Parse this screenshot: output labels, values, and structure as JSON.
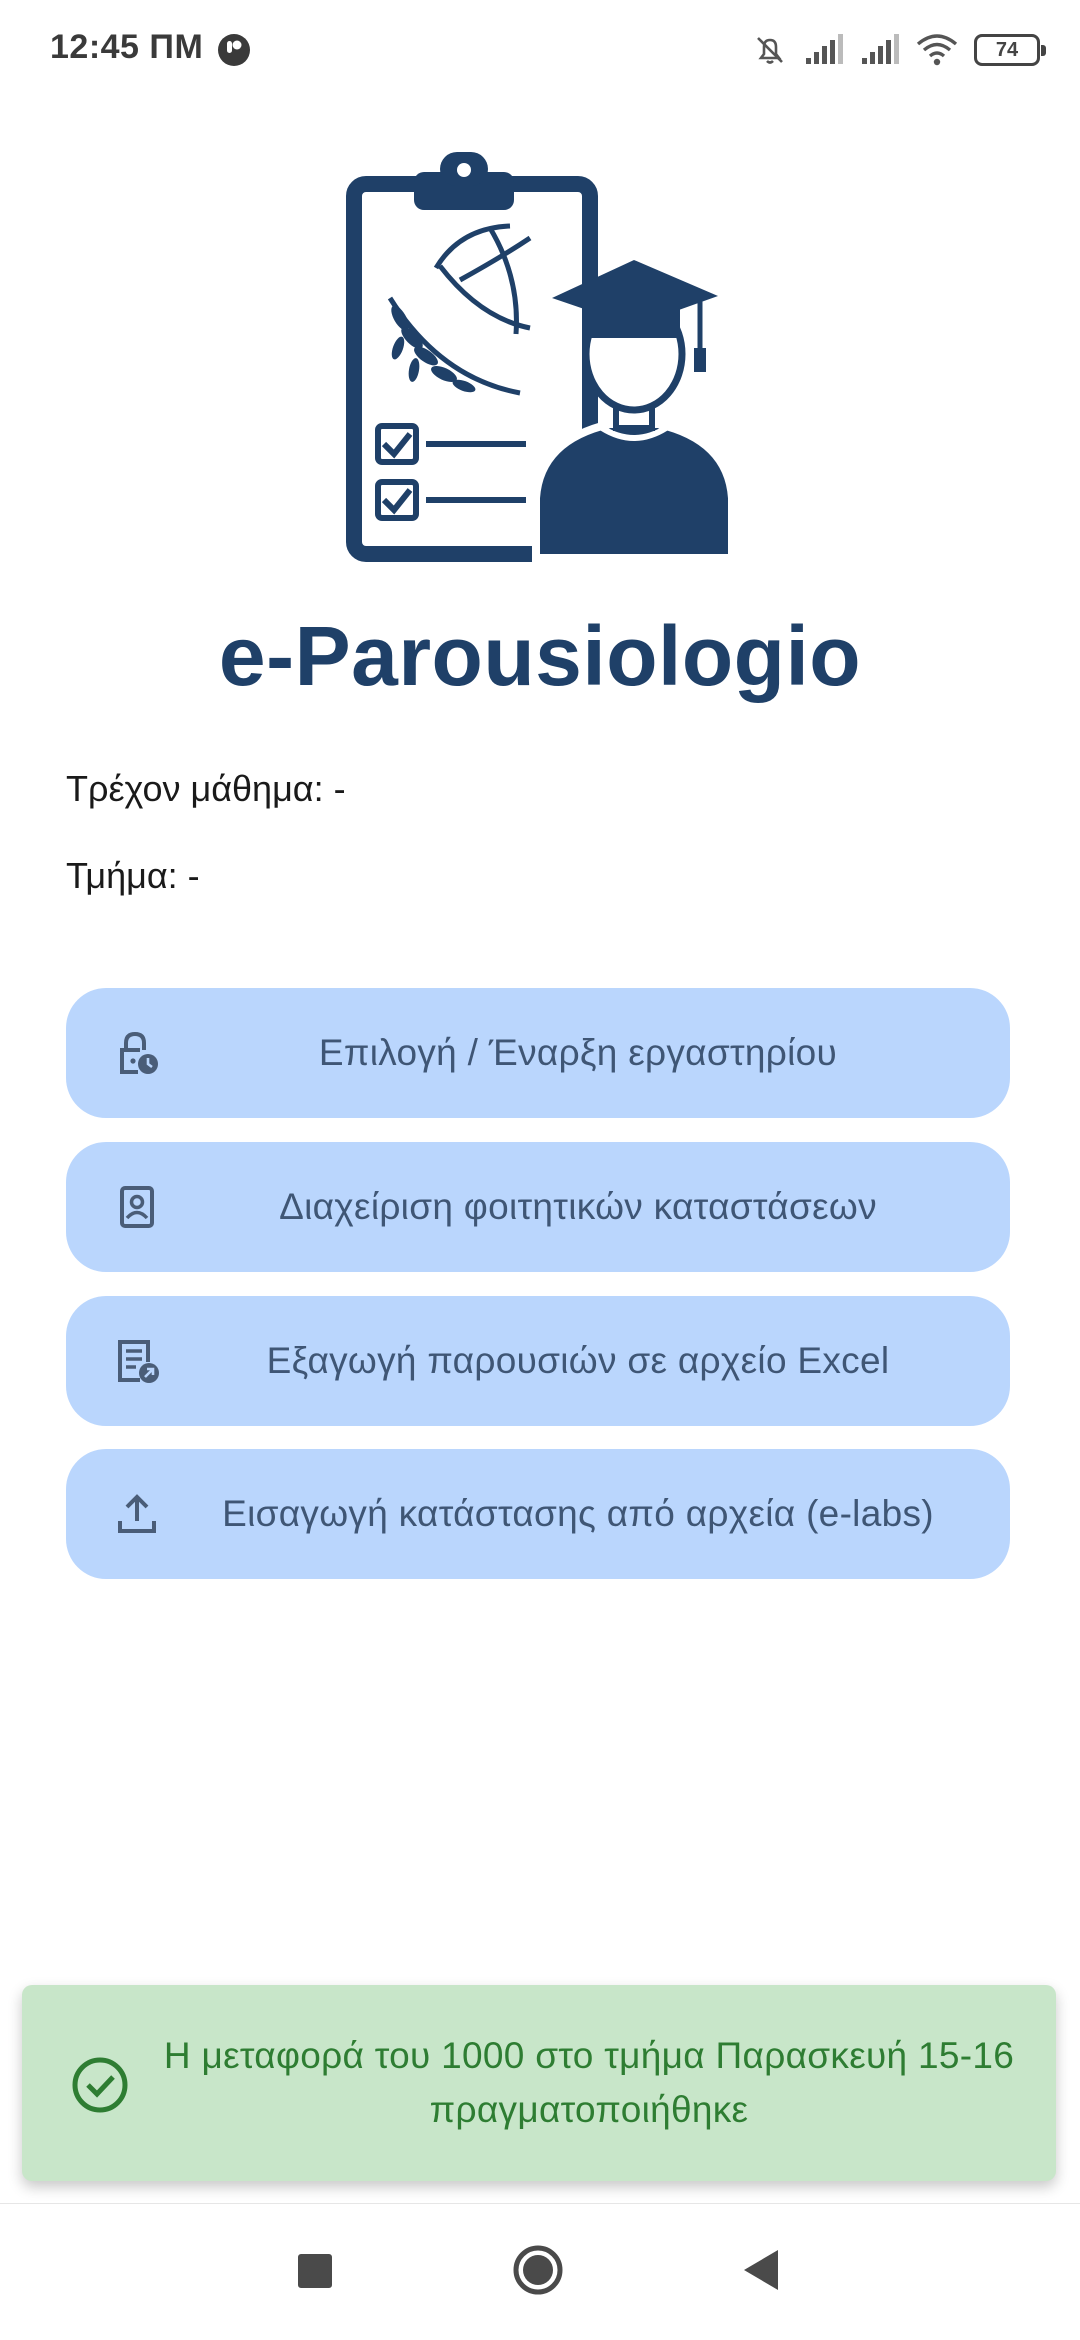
{
  "status_bar": {
    "time": "12:45 ΠΜ",
    "battery": "74",
    "icons": [
      "app-notification-icon",
      "notifications-off-icon",
      "signal-icon",
      "signal-icon",
      "wifi-icon",
      "battery-icon"
    ]
  },
  "app": {
    "title": "e-Parousiologio",
    "logo_icon": "clipboard-graduate-logo"
  },
  "info": {
    "course_label": "Τρέχον μάθημα: -",
    "section_label": "Τμήμα: -"
  },
  "buttons": [
    {
      "label": "Επιλογή / Έναρξη εργαστηρίου",
      "icon": "lock-clock-icon"
    },
    {
      "label": "Διαχείριση φοιτητικών καταστάσεων",
      "icon": "contact-card-icon"
    },
    {
      "label": "Εξαγωγή παρουσιών σε αρχείο Excel",
      "icon": "export-document-icon"
    },
    {
      "label": "Εισαγωγή κατάστασης από αρχεία (e-labs)",
      "icon": "upload-icon"
    }
  ],
  "snackbar": {
    "message": "Η μεταφορά του  1000  στο τμήμα Παρασκευή 15-16 πραγματοποιήθηκε",
    "icon": "check-circle-icon",
    "color": "#2e7d32",
    "background": "#c8e6c9"
  },
  "nav_bar": {
    "icons": [
      "recents-icon",
      "home-icon",
      "back-icon"
    ]
  },
  "colors": {
    "primary": "#1f4068",
    "button_bg": "#bad6fd",
    "button_text": "#3f5675"
  }
}
